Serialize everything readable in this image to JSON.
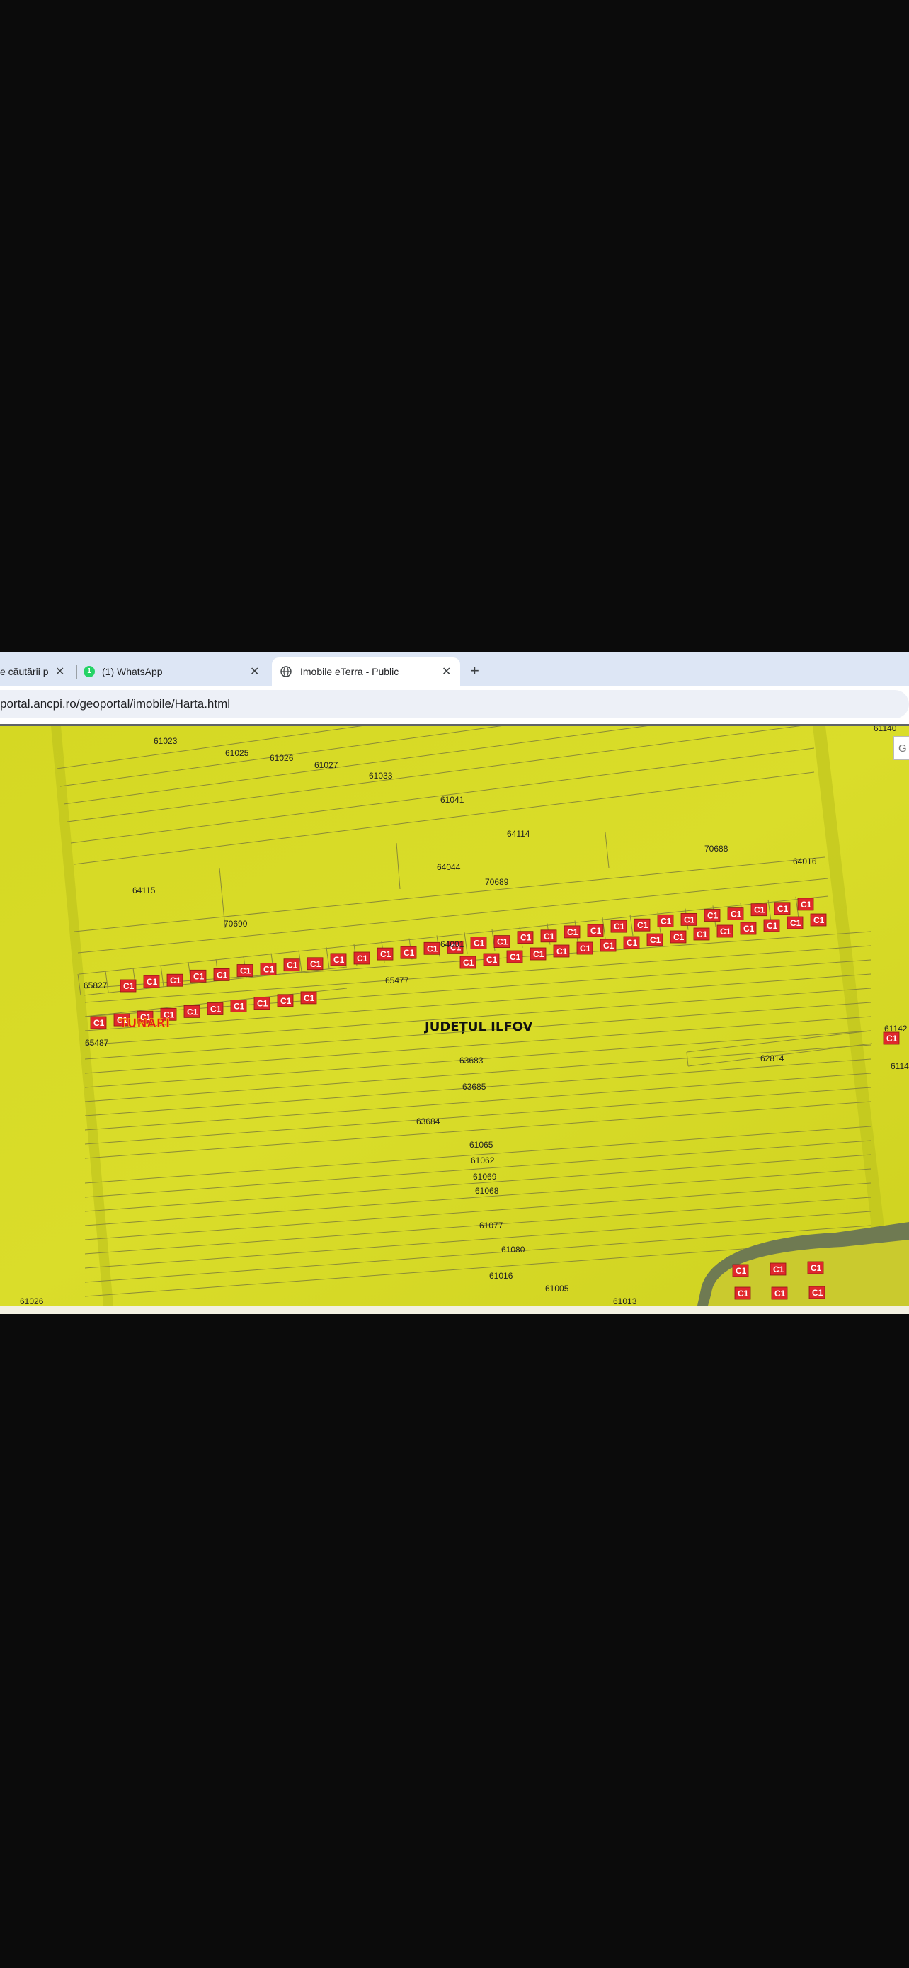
{
  "tabs": [
    {
      "title": "e căutării p",
      "active": false
    },
    {
      "title": "(1) WhatsApp",
      "badge": "1",
      "active": false
    },
    {
      "title": "Imobile eTerra - Public",
      "active": true
    }
  ],
  "close_glyph": "✕",
  "new_tab_glyph": "+",
  "address": {
    "url": "portal.ancpi.ro/geoportal/imobile/Harta.html"
  },
  "map": {
    "region_label": "JUDEȚUL ILFOV",
    "town_label": "TUNARI",
    "building_label": "C1",
    "search_hint": "G",
    "parcel_labels": [
      "61023",
      "61025",
      "61026",
      "61027",
      "61033",
      "61041",
      "64114",
      "70688",
      "64016",
      "64044",
      "70689",
      "64115",
      "70690",
      "64001",
      "65477",
      "65827",
      "65487",
      "63683",
      "62814",
      "63685",
      "63684",
      "61065",
      "61062",
      "61069",
      "61068",
      "61077",
      "61080",
      "61016",
      "61005",
      "61140",
      "61142",
      "6114",
      "61026",
      "61013"
    ],
    "colors": {
      "fill": "#d9dc24",
      "lines": "#8a8a38",
      "building": "#e0282c"
    }
  }
}
